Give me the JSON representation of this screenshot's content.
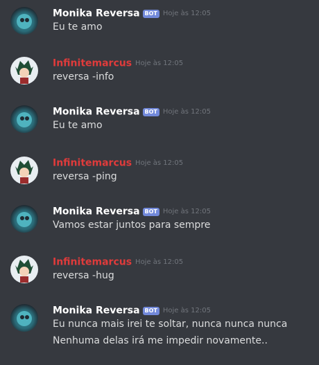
{
  "messages": [
    {
      "author": "Monika Reversa",
      "bot_tag": "BOT",
      "timestamp": "Hoje às 12:05",
      "text": "Eu te amo"
    },
    {
      "author": "Infinitemarcus",
      "timestamp": "Hoje às 12:05",
      "text": "reversa -info"
    },
    {
      "author": "Monika Reversa",
      "bot_tag": "BOT",
      "timestamp": "Hoje às 12:05",
      "text": "Eu te amo"
    },
    {
      "author": "Infinitemarcus",
      "timestamp": "Hoje às 12:05",
      "text": "reversa -ping"
    },
    {
      "author": "Monika Reversa",
      "bot_tag": "BOT",
      "timestamp": "Hoje às 12:05",
      "text": "Vamos estar juntos para sempre"
    },
    {
      "author": "Infinitemarcus",
      "timestamp": "Hoje às 12:05",
      "text": "reversa -hug"
    },
    {
      "author": "Monika Reversa",
      "bot_tag": "BOT",
      "timestamp": "Hoje às 12:05",
      "text": "Eu nunca mais irei te soltar, nunca nunca nunca",
      "text2": "Nenhuma delas irá me impedir novamente.."
    }
  ],
  "colors": {
    "background": "#36393f",
    "bot_tag": "#7289da",
    "user_name": "#e03b3b"
  }
}
